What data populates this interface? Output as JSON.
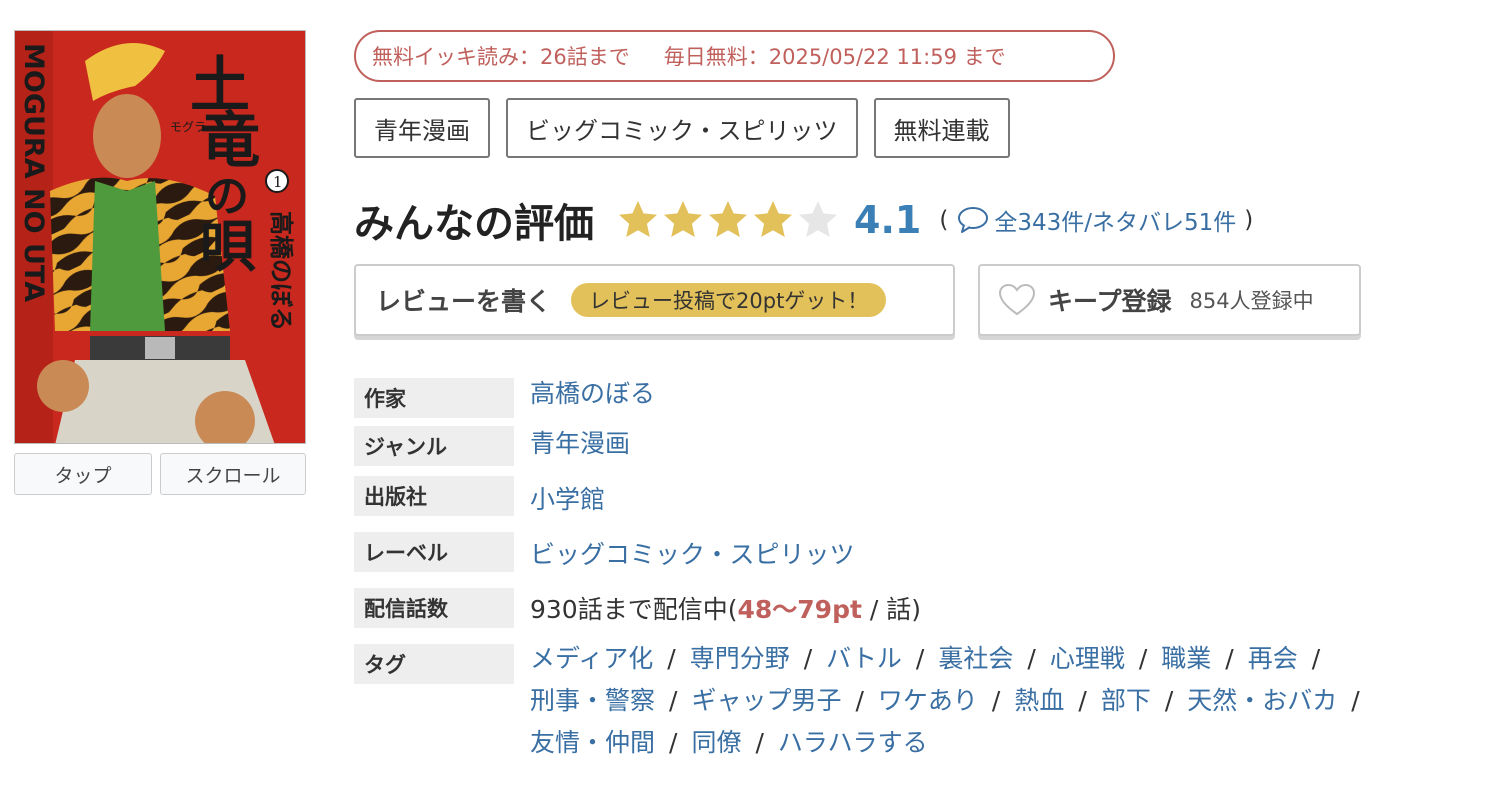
{
  "cover": {
    "title_chars": [
      "土",
      "竜",
      "の",
      "唄"
    ],
    "furigana": "モグラ",
    "author_vertical": "高橋のぼる",
    "romaji_vertical": "MOGURA NO UTA",
    "volume": "1",
    "tap_label": "タップ",
    "scroll_label": "スクロール"
  },
  "free_banner": {
    "binge_text": "無料イッキ読み：26話まで",
    "daily_text": "毎日無料：2025/05/22 11:59 まで"
  },
  "genre_tags": [
    "青年漫画",
    "ビッグコミック・スピリッツ",
    "無料連載"
  ],
  "rating": {
    "title": "みんなの評価",
    "stars": 4,
    "stars_max": 5,
    "score": "4.1",
    "open_paren": "(",
    "review_text": "全343件/ネタバレ51件",
    "close_paren": ")",
    "star_color": "#e2c05a",
    "score_color": "#3a7fb6"
  },
  "actions": {
    "review_label": "レビューを書く",
    "review_badge": "レビュー投稿で20ptゲット！",
    "keep_label": "キープ登録",
    "keep_count": "854人登録中"
  },
  "info": {
    "author_label": "作家",
    "author_value": "高橋のぼる",
    "genre_label": "ジャンル",
    "genre_value": "青年漫画",
    "publisher_label": "出版社",
    "publisher_value": "小学館",
    "label_label": "レーベル",
    "label_value": "ビッグコミック・スピリッツ",
    "episodes_label": "配信話数",
    "episodes_prefix": "930話まで配信中(",
    "episodes_price": "48〜79pt",
    "episodes_suffix": " / 話)",
    "tags_label": "タグ"
  },
  "tags": [
    "メディア化",
    "専門分野",
    "バトル",
    "裏社会",
    "心理戦",
    "職業",
    "再会",
    "刑事・警察",
    "ギャップ男子",
    "ワケあり",
    "熱血",
    "部下",
    "天然・おバカ",
    "友情・仲間",
    "同僚",
    "ハラハラする"
  ],
  "tag_separator": "/"
}
